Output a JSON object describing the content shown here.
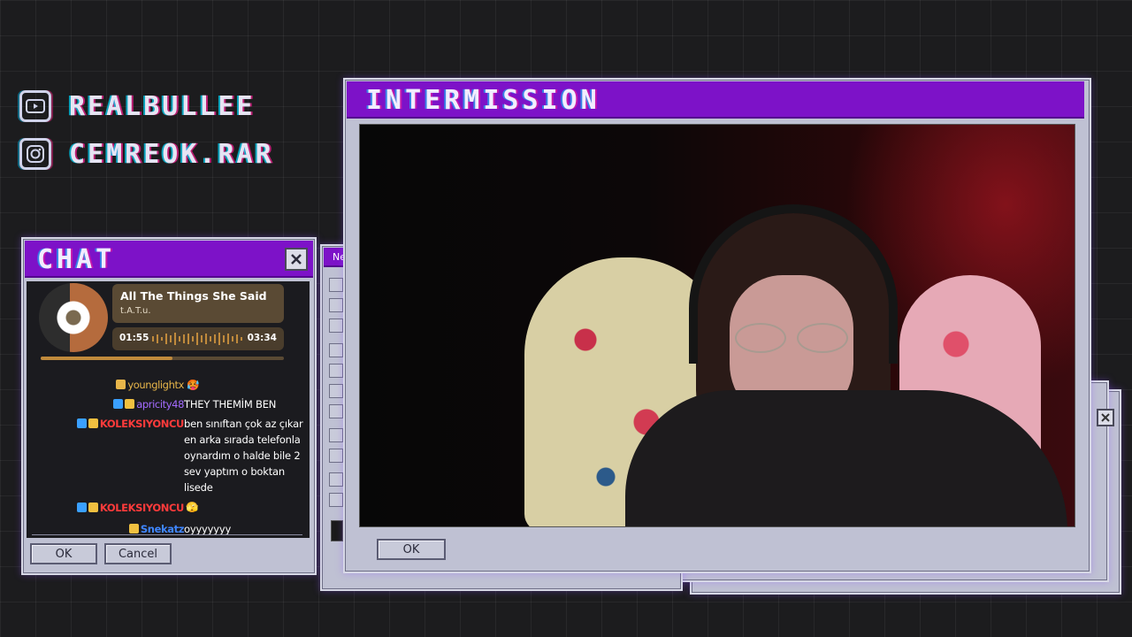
{
  "socials": [
    {
      "icon": "youtube-icon",
      "handle": "REALBULLEE"
    },
    {
      "icon": "instagram-icon",
      "handle": "CEMREOK.RAR"
    }
  ],
  "chat_window": {
    "title": "CHAT",
    "ok_label": "OK",
    "cancel_label": "Cancel"
  },
  "now_playing": {
    "song": "All The Things She Said",
    "artist": "t.A.T.u.",
    "elapsed": "01:55",
    "duration": "03:34",
    "progress": 0.54
  },
  "chat_messages": [
    {
      "user": "younglightx",
      "user_color": "#e8b64a",
      "text": "🥵"
    },
    {
      "user": "apricity48",
      "user_color": "#a36bff",
      "text": "THEY THEMİM BEN"
    },
    {
      "user": "KOLEKSIYONCU",
      "user_color": "#ff3b3b",
      "text": "ben sınıftan çok az çıkar en arka sırada telefonla oynardım o halde bile 2 sev yaptım o boktan lisede"
    },
    {
      "user": "KOLEKSIYONCU",
      "user_color": "#ff3b3b",
      "text": "🫣"
    },
    {
      "user": "Snekatz",
      "user_color": "#3f86ff",
      "text": "oyyyyyyy"
    }
  ],
  "paint_window": {
    "title_fragment": "Ne"
  },
  "main_window": {
    "title": "INTERMISSION",
    "ok_label": "OK"
  },
  "colors": {
    "titlebar": "#7d12c8",
    "window_bg": "#bfc1d3",
    "chat_bg": "#1b1b1f",
    "player_card": "#5a4a34",
    "player_accent": "#c08a3c"
  }
}
